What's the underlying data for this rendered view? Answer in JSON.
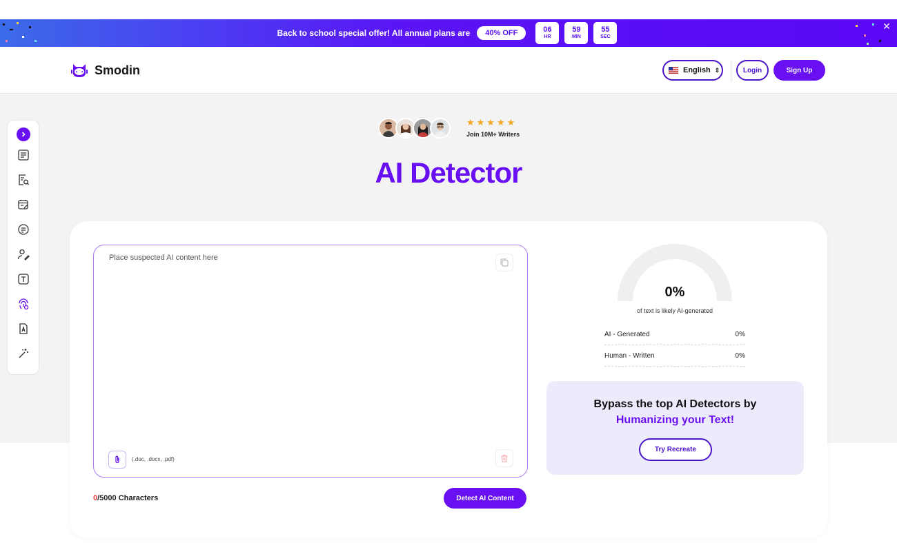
{
  "promo": {
    "text": "Back to school special offer! All annual plans are",
    "badge": "40% OFF",
    "countdown": [
      {
        "value": "06",
        "unit": "HR"
      },
      {
        "value": "59",
        "unit": "MIN"
      },
      {
        "value": "55",
        "unit": "SEC"
      }
    ],
    "close_icon": "close-icon"
  },
  "header": {
    "brand": "Smodin",
    "language": "English",
    "login_label": "Login",
    "signup_label": "Sign Up"
  },
  "sidebar": {
    "items": [
      "expand-icon",
      "document-icon",
      "document-search-icon",
      "notes-edit-icon",
      "chat-document-icon",
      "user-pen-icon",
      "text-box-icon",
      "fingerprint-icon",
      "file-a-icon",
      "magic-wand-icon"
    ]
  },
  "hero": {
    "rating_stars": "★★★★★",
    "social_proof": "Join 10M+ Writers",
    "title": "AI Detector"
  },
  "editor": {
    "placeholder": "Place suspected AI content here",
    "value": "",
    "file_types": "(.doc, .docx, .pdf)",
    "char_count_current": "0",
    "char_count_rest": "/5000 Characters",
    "detect_label": "Detect AI Content"
  },
  "results": {
    "percent": "0%",
    "percent_value": 0,
    "caption": "of text is likely AI-generated",
    "rows": [
      {
        "label": "AI - Generated",
        "value": "0%"
      },
      {
        "label": "Human - Written",
        "value": "0%"
      }
    ]
  },
  "bypass": {
    "line1": "Bypass the top AI Detectors by",
    "line2": "Humanizing your Text!",
    "button_label": "Try Recreate"
  },
  "colors": {
    "accent": "#6910f2",
    "accent_dark": "#4a14c8",
    "star": "#f5a623",
    "bypass_bg": "#ecebfc"
  }
}
